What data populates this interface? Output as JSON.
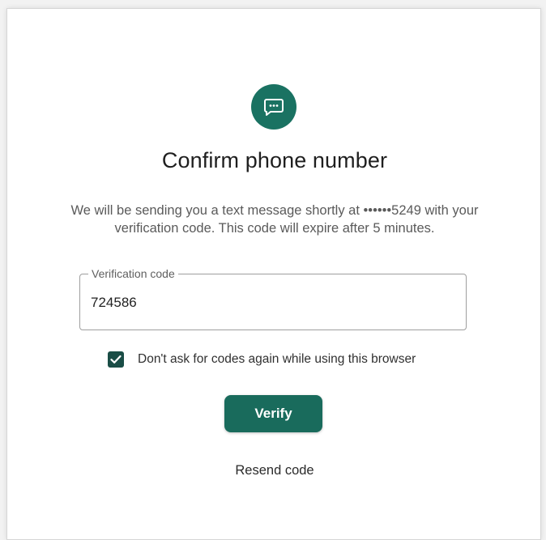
{
  "dialog": {
    "icon": "chat-bubble-icon",
    "title": "Confirm phone number",
    "description": "We will be sending you a text message shortly at ••••••5249 with your verification code. This code will expire after 5 minutes."
  },
  "code_field": {
    "label": "Verification code",
    "value": "724586"
  },
  "remember": {
    "checked": true,
    "label": "Don't ask for codes again while using this browser"
  },
  "actions": {
    "verify_label": "Verify",
    "resend_label": "Resend code"
  },
  "colors": {
    "accent": "#1a7262",
    "button": "#196b5c",
    "checkbox": "#1a4d46"
  }
}
